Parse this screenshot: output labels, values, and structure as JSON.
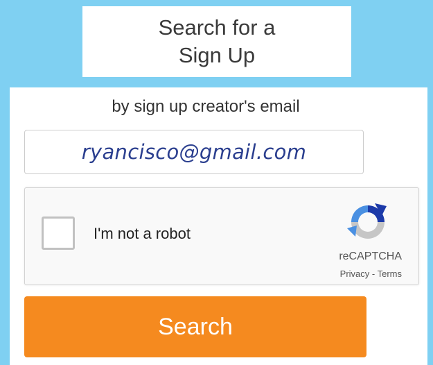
{
  "header": {
    "title": "Search for a Sign Up"
  },
  "form": {
    "subtitle": "by sign up creator's email",
    "email_value": "ryancisco@gmail.com",
    "search_label": "Search"
  },
  "captcha": {
    "label": "I'm not a robot",
    "brand": "reCAPTCHA",
    "privacy": "Privacy",
    "separator": " - ",
    "terms": "Terms",
    "checked": false,
    "icon": "recaptcha-logo-icon"
  },
  "colors": {
    "background": "#7fd0f2",
    "button": "#f58a1f",
    "email_text": "#2b3f8f"
  }
}
